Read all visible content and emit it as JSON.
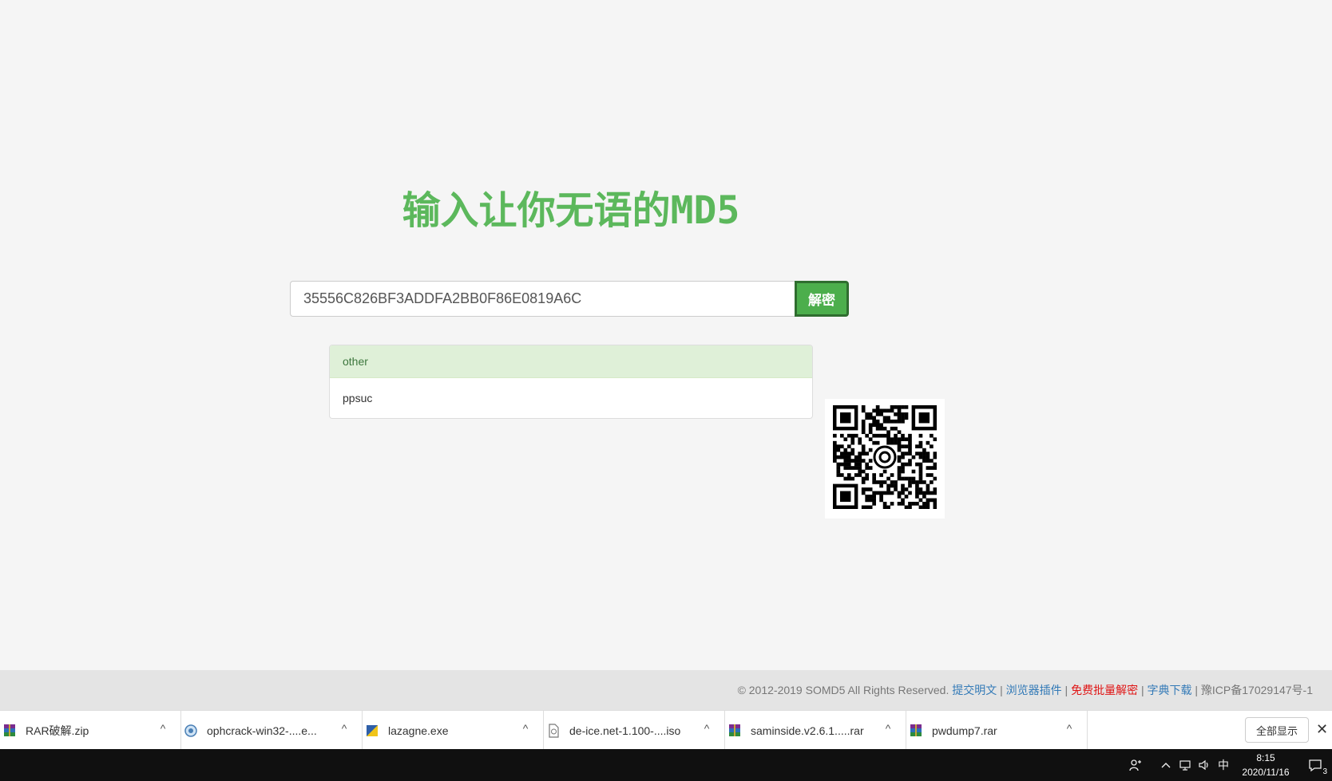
{
  "page": {
    "title": "输入让你无语的MD5"
  },
  "search": {
    "value": "35556C826BF3ADDFA2BB0F86E0819A6C",
    "button_label": "解密"
  },
  "results": {
    "header": "other",
    "items": [
      "ppsuc"
    ]
  },
  "footer": {
    "copyright": "© 2012-2019 SOMD5 All Rights Reserved. ",
    "links": [
      "提交明文",
      "浏览器插件",
      "免费批量解密",
      "字典下载"
    ],
    "sep": " | ",
    "icp": "豫ICP备17029147号-1"
  },
  "downloads": {
    "items": [
      {
        "name": "RAR破解.zip",
        "icon": "winrar-icon"
      },
      {
        "name": "ophcrack-win32-....e...",
        "icon": "installer-icon"
      },
      {
        "name": "lazagne.exe",
        "icon": "exe-icon"
      },
      {
        "name": "de-ice.net-1.100-....iso",
        "icon": "iso-file-icon"
      },
      {
        "name": "saminside.v2.6.1.....rar",
        "icon": "winrar-icon"
      },
      {
        "name": "pwdump7.rar",
        "icon": "winrar-icon"
      }
    ],
    "show_all_label": "全部显示",
    "close_glyph": "✕",
    "caret_glyph": "^"
  },
  "taskbar": {
    "time": "8:15",
    "date": "2020/11/16",
    "ime": "中",
    "notification_count": "3"
  },
  "colors": {
    "accent_green": "#5cb85c",
    "button_green": "#4cae4c",
    "link_blue": "#337ab7",
    "link_red": "#e01515"
  }
}
